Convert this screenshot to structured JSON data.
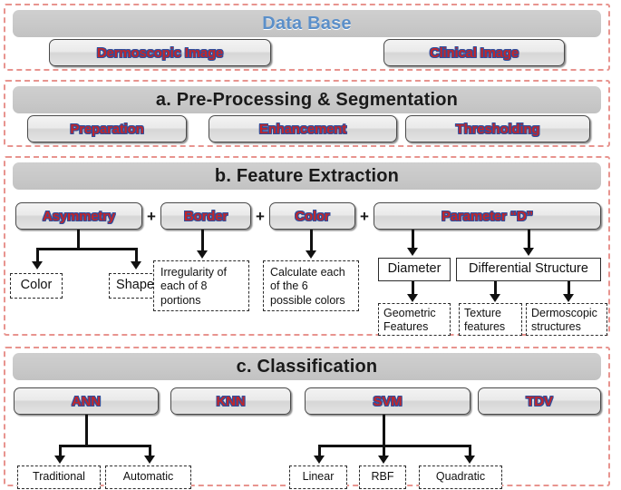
{
  "sections": [
    {
      "id": "database",
      "title": "Data Base",
      "title_color": "#5b8fc9",
      "items": [
        "Dermoscopic Image",
        "Clinical Image"
      ]
    },
    {
      "id": "preprocessing",
      "title": "a. Pre-Processing & Segmentation",
      "title_color": "#1a1a1a",
      "items": [
        "Preparation",
        "Enhancement",
        "Thresholding"
      ]
    },
    {
      "id": "feature-extraction",
      "title": "b. Feature Extraction",
      "title_color": "#1a1a1a",
      "items": [
        "Asymmetry",
        "Border",
        "Color",
        "Parameter “D”"
      ],
      "operators": [
        "+",
        "+",
        "+"
      ],
      "asymmetry_children": [
        "Color",
        "Shape"
      ],
      "border_child": "Irregularity of\neach of 8\nportions",
      "color_child": "Calculate each\nof the 6\npossible colors",
      "parameter_children": [
        "Diameter",
        "Differential Structure"
      ],
      "diameter_child": "Geometric\nFeatures",
      "differential_children": [
        "Texture\nfeatures",
        "Dermoscopic\nstructures"
      ]
    },
    {
      "id": "classification",
      "title": "c. Classification",
      "title_color": "#1a1a1a",
      "items": [
        "ANN",
        "KNN",
        "SVM",
        "TDV"
      ],
      "ann_children": [
        "Traditional",
        "Automatic"
      ],
      "svm_children": [
        "Linear",
        "RBF",
        "Quadratic"
      ]
    }
  ],
  "colors": {
    "section_border": "#e8948f",
    "bar_fill": "#c8c8c8",
    "button_text_fill": "#c0262b",
    "button_text_outline": "#2f4f9e",
    "connector": "#111111"
  }
}
